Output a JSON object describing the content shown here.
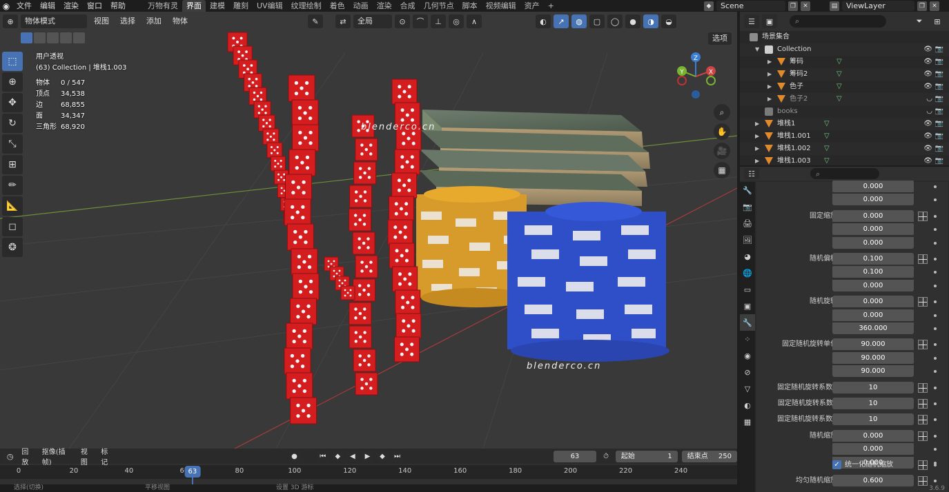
{
  "topbar": {
    "menus": [
      "文件",
      "编辑",
      "渲染",
      "窗口",
      "帮助"
    ],
    "workspaces": [
      "万物有灵",
      "界面",
      "建模",
      "雕刻",
      "UV编辑",
      "纹理绘制",
      "着色",
      "动画",
      "渲染",
      "合成",
      "几何节点",
      "脚本",
      "视频编辑",
      "资产"
    ],
    "active_workspace": "界面",
    "plus": "+",
    "scene": "Scene",
    "view_layer": "ViewLayer"
  },
  "viewport": {
    "mode": "物体模式",
    "menus": [
      "视图",
      "选择",
      "添加",
      "物体"
    ],
    "orientation": "全局",
    "select_button": "选项",
    "view_name": "用户透视",
    "collection_info": "(63) Collection | 堆栈1.003",
    "stats": [
      {
        "label": "物体",
        "value": "0 / 547"
      },
      {
        "label": "顶点",
        "value": "34,538"
      },
      {
        "label": "边",
        "value": "68,855"
      },
      {
        "label": "面",
        "value": "34,347"
      },
      {
        "label": "三角形",
        "value": "68,920"
      }
    ],
    "watermark1": "blenderco.cn",
    "watermark2": "blenderco.cn",
    "gizmo": {
      "x": "X",
      "y": "Y",
      "z": "Z"
    }
  },
  "timeline": {
    "menus": [
      "回放",
      "抠像(插帧)",
      "视图",
      "标记"
    ],
    "current_frame": "63",
    "start_label": "起始",
    "start": "1",
    "end_label": "结束点",
    "end": "250",
    "ticks": [
      "0",
      "20",
      "40",
      "60",
      "80",
      "100",
      "120",
      "140",
      "160",
      "180",
      "200",
      "220",
      "240"
    ],
    "playhead": "63",
    "status": [
      "选择(切换)",
      "平移视图",
      "设置 3D 游标"
    ]
  },
  "outliner": {
    "root": "场景集合",
    "rows": [
      {
        "label": "Collection",
        "indent": 1,
        "icon": "collection",
        "dim": false
      },
      {
        "label": "筹码",
        "indent": 2,
        "icon": "mesh",
        "dim": false
      },
      {
        "label": "筹码2",
        "indent": 2,
        "icon": "mesh",
        "dim": false
      },
      {
        "label": "色子",
        "indent": 2,
        "icon": "mesh",
        "dim": false
      },
      {
        "label": "色子2",
        "indent": 2,
        "icon": "mesh",
        "dim": true
      },
      {
        "label": "books",
        "indent": 1,
        "icon": "collection",
        "dim": true
      },
      {
        "label": "堆栈1",
        "indent": 1,
        "icon": "mesh",
        "dim": false
      },
      {
        "label": "堆栈1.001",
        "indent": 1,
        "icon": "mesh",
        "dim": false
      },
      {
        "label": "堆栈1.002",
        "indent": 1,
        "icon": "mesh",
        "dim": false
      },
      {
        "label": "堆栈1.003",
        "indent": 1,
        "icon": "mesh",
        "dim": false
      }
    ]
  },
  "properties": {
    "rows": [
      {
        "label": "",
        "value": "0.000",
        "pos": "mid",
        "mix": false
      },
      {
        "label": "",
        "value": "0.000",
        "pos": "bot",
        "mix": false
      },
      {
        "label": "固定缩放",
        "value": "0.000",
        "pos": "top",
        "mix": true
      },
      {
        "label": "",
        "value": "0.000",
        "pos": "mid",
        "mix": false
      },
      {
        "label": "",
        "value": "0.000",
        "pos": "bot",
        "mix": false
      },
      {
        "label": "随机偏移",
        "value": "0.100",
        "pos": "top",
        "mix": true
      },
      {
        "label": "",
        "value": "0.100",
        "pos": "mid",
        "mix": false
      },
      {
        "label": "",
        "value": "0.000",
        "pos": "bot",
        "mix": false
      },
      {
        "label": "随机旋转",
        "value": "0.000",
        "pos": "top",
        "mix": true
      },
      {
        "label": "",
        "value": "0.000",
        "pos": "mid",
        "mix": false
      },
      {
        "label": "",
        "value": "360.000",
        "pos": "bot",
        "mix": false
      },
      {
        "label": "固定随机旋转单位",
        "value": "90.000",
        "pos": "top",
        "mix": true
      },
      {
        "label": "",
        "value": "90.000",
        "pos": "mid",
        "mix": false
      },
      {
        "label": "",
        "value": "90.000",
        "pos": "bot",
        "mix": false
      },
      {
        "label": "固定随机旋转系数X",
        "value": "10",
        "pos": "single",
        "mix": true
      },
      {
        "label": "固定随机旋转系数Y",
        "value": "10",
        "pos": "single",
        "mix": true
      },
      {
        "label": "固定随机旋转系数Z",
        "value": "10",
        "pos": "single",
        "mix": true
      },
      {
        "label": "随机缩放",
        "value": "0.000",
        "pos": "top",
        "mix": true
      },
      {
        "label": "",
        "value": "0.000",
        "pos": "mid",
        "mix": false
      },
      {
        "label": "",
        "value": "0.000",
        "pos": "bot",
        "mix": false
      }
    ],
    "checkbox_label": "统一化随机缩放",
    "last_label": "均匀随机缩放",
    "last_value": "0.600",
    "version": "3.6.9"
  }
}
